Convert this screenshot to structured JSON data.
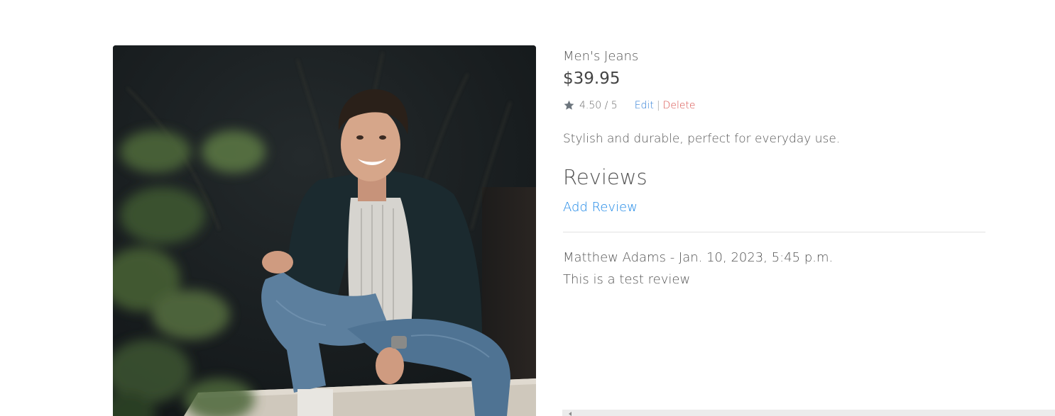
{
  "product": {
    "name": "Men's Jeans",
    "price": "$39.95",
    "rating": "4.50 / 5",
    "edit_label": "Edit",
    "separator": "|",
    "delete_label": "Delete",
    "description": "Stylish and durable, perfect for everyday use.",
    "image_alt": "Smiling man in jeans and dark jacket sitting on a ledge"
  },
  "reviews": {
    "heading": "Reviews",
    "add_label": "Add Review",
    "items": [
      {
        "meta": "Matthew Adams - Jan. 10, 2023, 5:45 p.m.",
        "text": "This is a test review"
      }
    ]
  },
  "colors": {
    "link_blue": "#1a86e6",
    "delete_red": "#d9534f",
    "text_gray": "#555555",
    "star_gray": "#6c757d"
  },
  "icons": {
    "rating": "star-icon",
    "scroll_left": "scroll-left-arrow-icon"
  }
}
